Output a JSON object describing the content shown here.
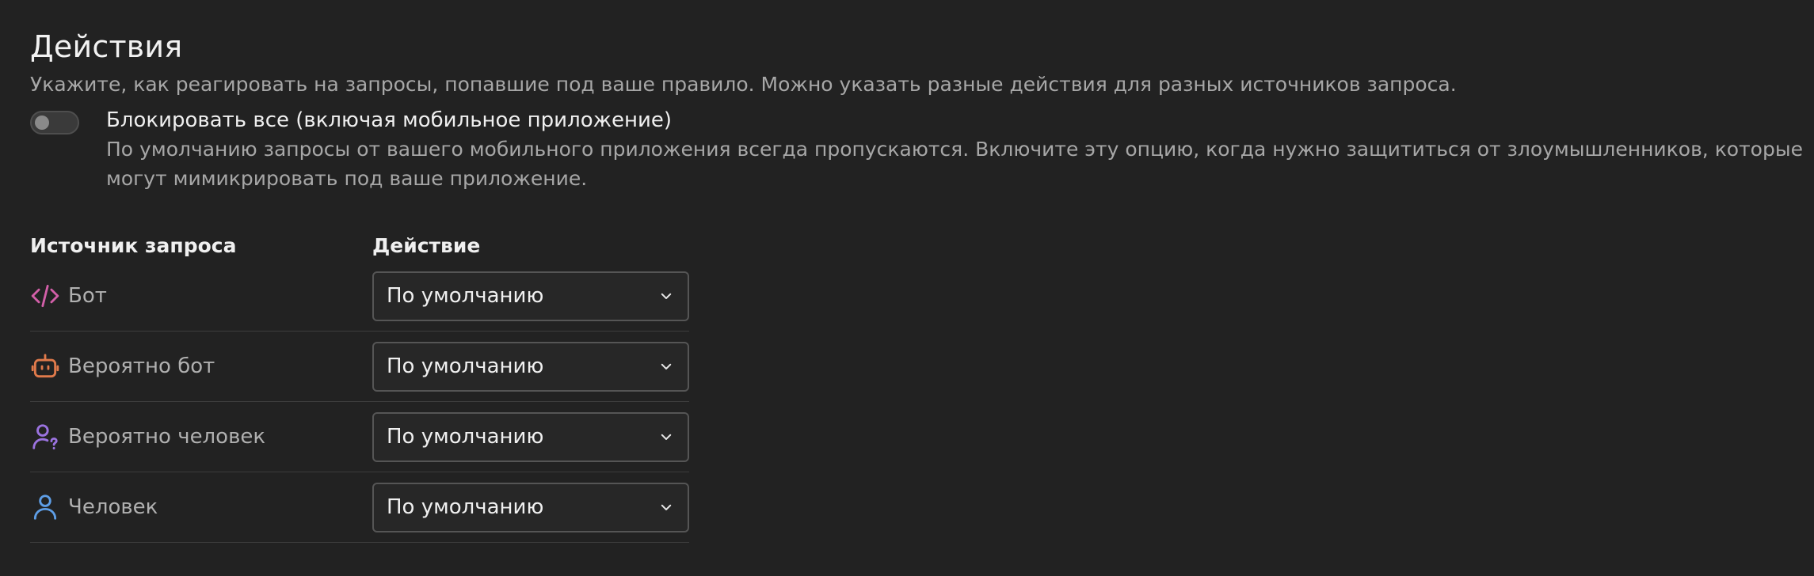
{
  "section": {
    "title": "Действия",
    "subtitle": "Укажите, как реагировать на запросы, попавшие под ваше правило. Можно указать разные действия для разных источников запроса."
  },
  "block_all": {
    "label": "Блокировать все (включая мобильное приложение)",
    "description": "По умолчанию запросы от вашего мобильного приложения всегда пропускаются. Включите эту опцию, когда нужно защититься от злоумышленников, которые могут мимикрировать под ваше приложение.",
    "enabled": false
  },
  "table": {
    "headers": {
      "source": "Источник запроса",
      "action": "Действие"
    },
    "rows": [
      {
        "icon": "code-icon",
        "icon_color": "#d25fa8",
        "label": "Бот",
        "action": "По умолчанию"
      },
      {
        "icon": "robot-icon",
        "icon_color": "#e07a4b",
        "label": "Вероятно бот",
        "action": "По умолчанию"
      },
      {
        "icon": "user-question-icon",
        "icon_color": "#9b73e0",
        "label": "Вероятно человек",
        "action": "По умолчанию"
      },
      {
        "icon": "user-icon",
        "icon_color": "#5e9ee6",
        "label": "Человек",
        "action": "По умолчанию"
      }
    ]
  }
}
